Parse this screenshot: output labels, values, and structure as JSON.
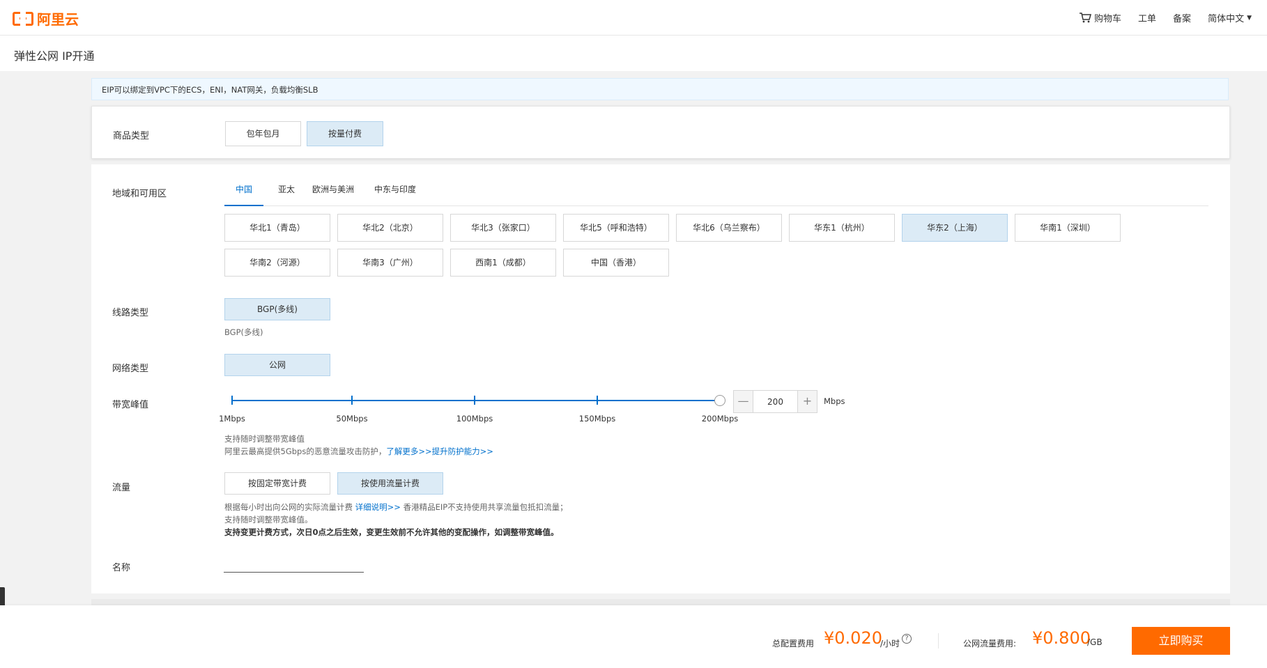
{
  "header": {
    "logo_text": "阿里云",
    "nav": {
      "cart": "购物车",
      "ticket": "工单",
      "filing": "备案",
      "language": "简体中文"
    }
  },
  "page_title": "弹性公网 IP开通",
  "notice": "EIP可以绑定到VPC下的ECS，ENI，NAT网关，负载均衡SLB",
  "product_type": {
    "label": "商品类型",
    "options": [
      "包年包月",
      "按量付费"
    ],
    "selected": "按量付费"
  },
  "region": {
    "label": "地域和可用区",
    "tabs": [
      "中国",
      "亚太",
      "欧洲与美洲",
      "中东与印度"
    ],
    "active_tab": "中国",
    "options": [
      "华北1（青岛）",
      "华北2（北京）",
      "华北3（张家口）",
      "华北5（呼和浩特）",
      "华北6（乌兰察布）",
      "华东1（杭州）",
      "华东2（上海）",
      "华南1（深圳）",
      "华南2（河源）",
      "华南3（广州）",
      "西南1（成都）",
      "中国（香港）"
    ],
    "selected": "华东2（上海）"
  },
  "line_type": {
    "label": "线路类型",
    "option": "BGP(多线)",
    "hint": "BGP(多线)"
  },
  "network_type": {
    "label": "网络类型",
    "option": "公网"
  },
  "bandwidth": {
    "label": "带宽峰值",
    "ticks": [
      "1Mbps",
      "50Mbps",
      "100Mbps",
      "150Mbps",
      "200Mbps"
    ],
    "value": "200",
    "min": 1,
    "max": 200,
    "current": 200,
    "unit": "Mbps",
    "hint_line1": "支持随时调整带宽峰值",
    "hint_line2_prefix": "阿里云最高提供5Gbps的恶意流量攻击防护，",
    "hint_link": "了解更多>>提升防护能力>>"
  },
  "traffic": {
    "label": "流量",
    "options": [
      "按固定带宽计费",
      "按使用流量计费"
    ],
    "selected": "按使用流量计费",
    "hint_line1_prefix": "根据每小时出向公网的实际流量计费",
    "hint_line1_link": "详细说明>>",
    "hint_line1_suffix": "香港精品EIP不支持使用共享流量包抵扣流量；",
    "hint_line2": "支持随时调整带宽峰值。",
    "hint_line3": "支持变更计费方式，次日0点之后生效，变更生效前不允许其他的变配操作，如调整带宽峰值。"
  },
  "name": {
    "label": "名称",
    "value": ""
  },
  "footer": {
    "config_cost_label": "总配置费用",
    "config_cost": "¥0.020",
    "config_cost_unit": "/小时",
    "traffic_cost_label": "公网流量费用:",
    "traffic_cost": "¥0.800",
    "traffic_cost_unit": "/GB",
    "buy_button": "立即购买"
  },
  "colors": {
    "brand": "#ff6a00",
    "link": "#0070cc",
    "selected_bg": "#dcebf6"
  }
}
